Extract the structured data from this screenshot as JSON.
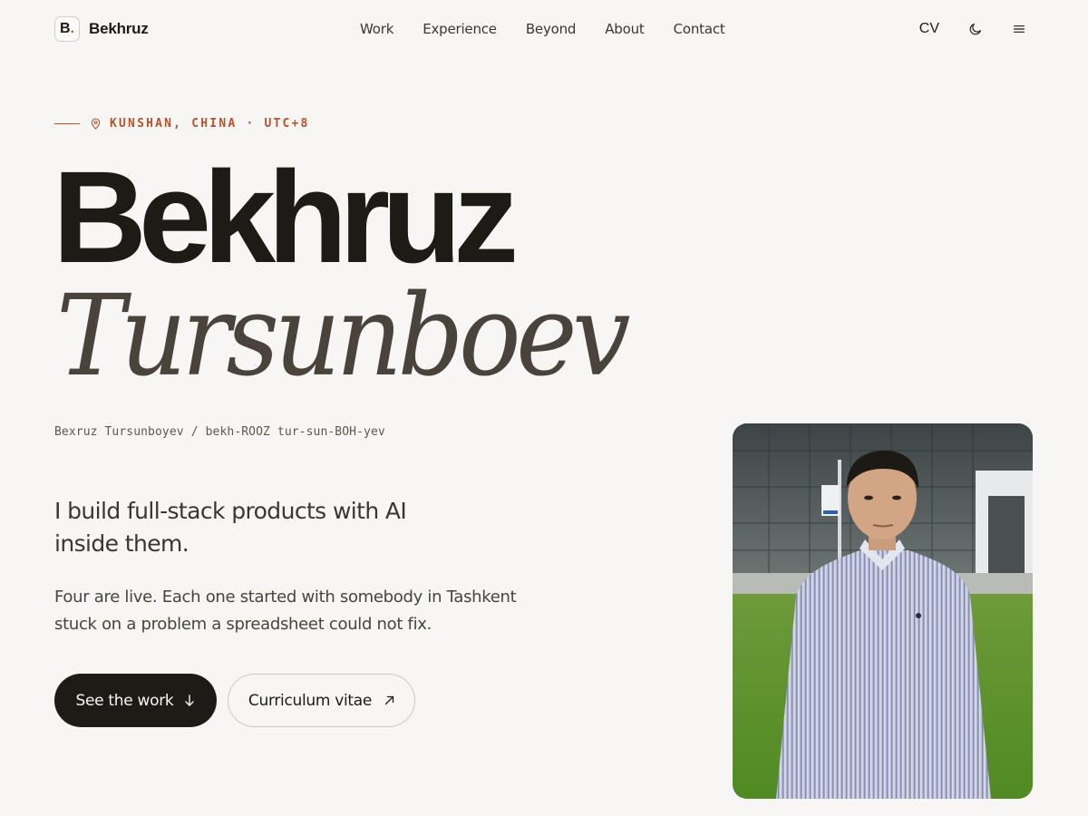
{
  "brand": {
    "mark": "B",
    "mark_dot": ".",
    "name": "Bekhruz"
  },
  "nav": {
    "items": [
      {
        "label": "Work"
      },
      {
        "label": "Experience"
      },
      {
        "label": "Beyond"
      },
      {
        "label": "About"
      },
      {
        "label": "Contact"
      }
    ]
  },
  "header_actions": {
    "cv_label": "CV",
    "theme_icon": "moon-icon",
    "menu_icon": "menu-icon"
  },
  "hero": {
    "location": "KUNSHAN, CHINA · UTC+8",
    "first_name": "Bekhruz",
    "last_name": "Tursunboev",
    "alt_spelling": "Bexruz Tursunboyev",
    "separator": "/",
    "pronunciation": "bekh-ROOZ tur-sun-BOH-yev",
    "headline": "I build full-stack products with AI inside them.",
    "blurb": "Four are live. Each one started with somebody in Tashkent stuck on a problem a spreadsheet could not fix.",
    "primary_button": "See the work",
    "secondary_button": "Curriculum vitae"
  },
  "colors": {
    "background": "#f8f6f4",
    "text": "#1e1b17",
    "accent": "#b5532a",
    "muted": "#4a433c"
  }
}
